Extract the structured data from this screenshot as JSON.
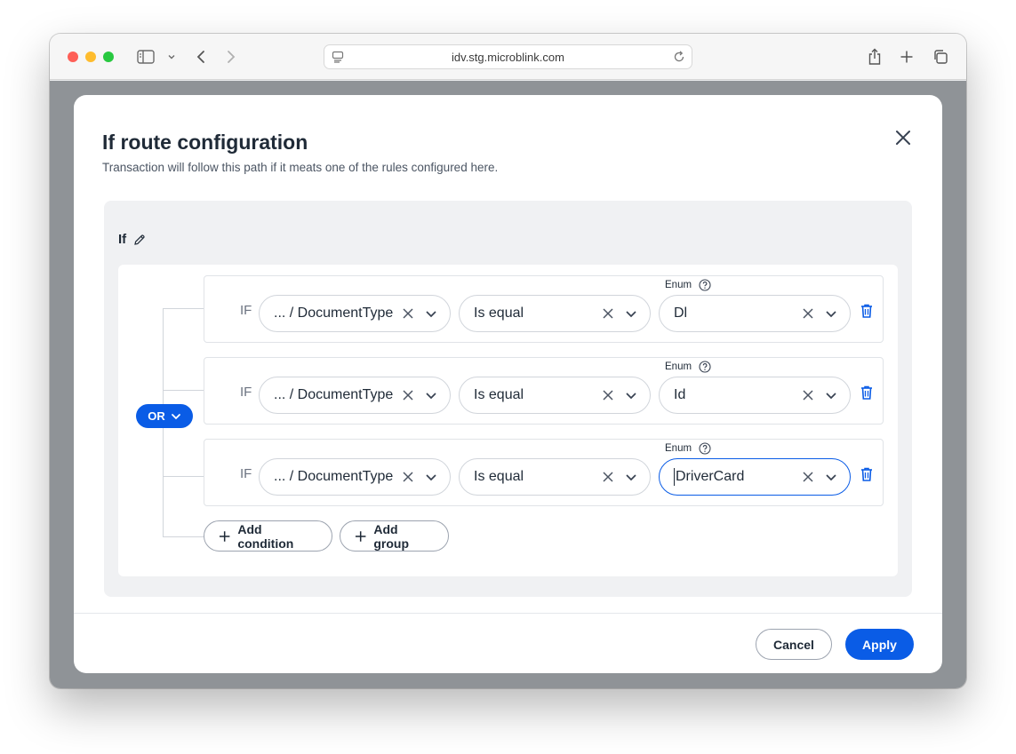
{
  "browser": {
    "url": "idv.stg.microblink.com"
  },
  "modal": {
    "title": "If route configuration",
    "subtitle": "Transaction will follow this path if it meats one of the rules configured here."
  },
  "panel": {
    "title": "If"
  },
  "group": {
    "operator": "OR"
  },
  "rules": [
    {
      "keyword": "IF",
      "field": "... / DocumentType",
      "operator": "Is equal",
      "value_label": "Enum",
      "value": "Dl"
    },
    {
      "keyword": "IF",
      "field": "... / DocumentType",
      "operator": "Is equal",
      "value_label": "Enum",
      "value": "Id"
    },
    {
      "keyword": "IF",
      "field": "... / DocumentType",
      "operator": "Is equal",
      "value_label": "Enum",
      "value": "DriverCard"
    }
  ],
  "actions": {
    "add_condition": "Add condition",
    "add_group": "Add group",
    "cancel": "Cancel",
    "apply": "Apply"
  },
  "colors": {
    "accent": "#0a5ce6",
    "trash": "#0a5ce6"
  }
}
